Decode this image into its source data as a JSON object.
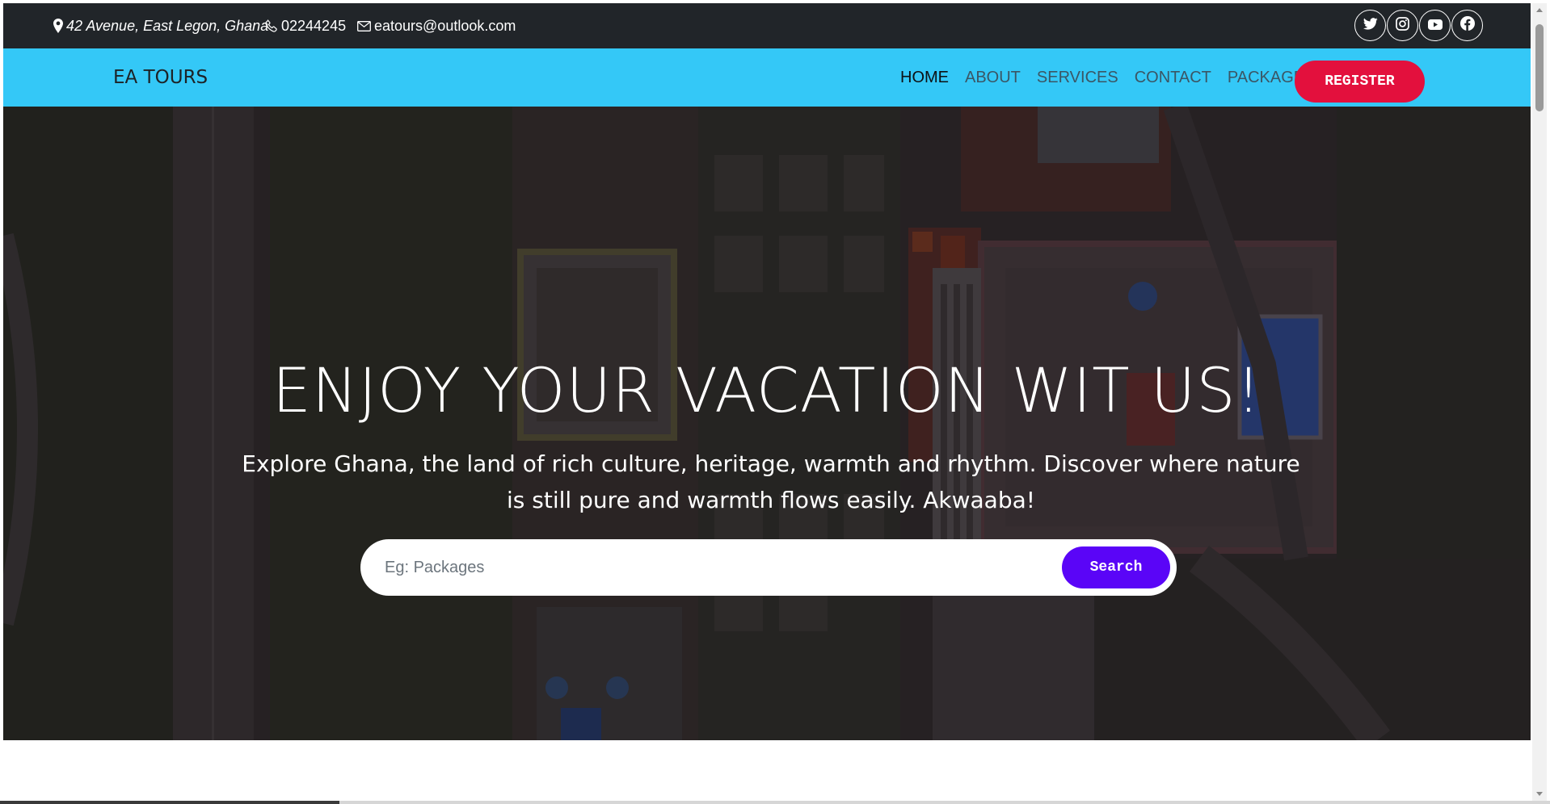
{
  "topbar": {
    "address": "42 Avenue, East Legon, Ghana",
    "phone": "02244245",
    "email": "eatours@outlook.com",
    "social": [
      "twitter-icon",
      "instagram-icon",
      "youtube-icon",
      "facebook-icon"
    ]
  },
  "navbar": {
    "brand": "EA TOURS",
    "links": {
      "home": "HOME",
      "about": "ABOUT",
      "services": "SERVICES",
      "contact": "CONTACT",
      "packages": "PACKAGES"
    },
    "register_label": "REGISTER"
  },
  "hero": {
    "title": "ENJOY YOUR VACATION WIT US!",
    "subtitle": "Explore Ghana, the land of rich culture, heritage, warmth and rhythm. Discover where nature is still pure and warmth flows easily. Akwaaba!",
    "search": {
      "placeholder": "Eg: Packages",
      "value": "",
      "button_label": "Search"
    }
  },
  "colors": {
    "topbar": "#212529",
    "navbar": "#34c8f7",
    "register": "#e3103d",
    "search_button": "#5a05f7"
  }
}
